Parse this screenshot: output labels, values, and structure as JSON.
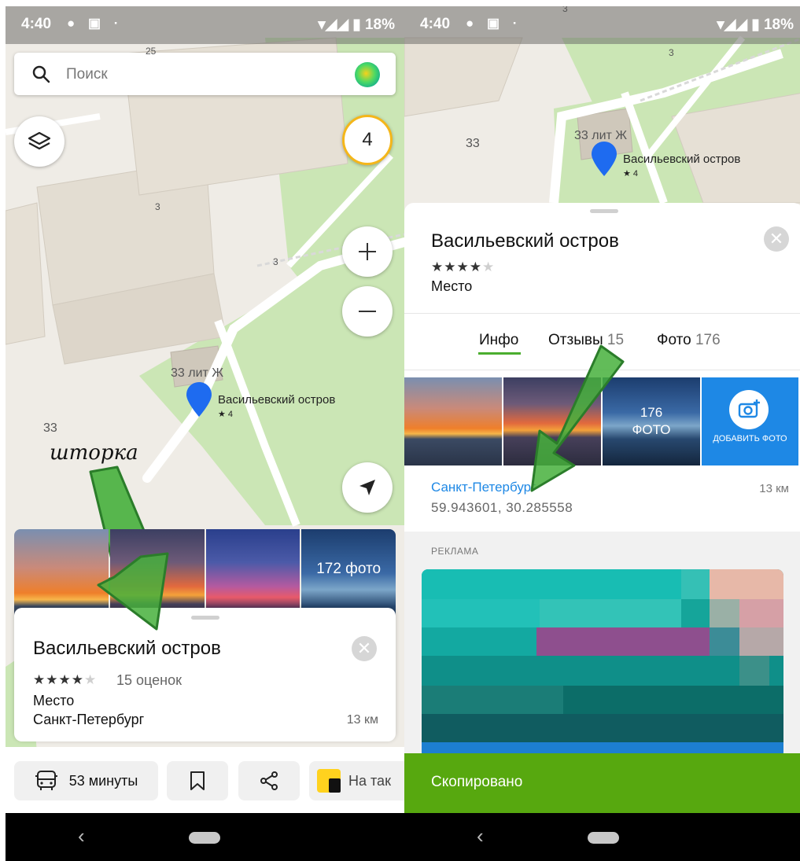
{
  "left_screen": {
    "status": {
      "time": "4:40",
      "battery": "18%"
    },
    "search": {
      "placeholder": "Поиск"
    },
    "traffic_level": "4",
    "map_labels": {
      "house_33": "33",
      "building": "33 лит Ж",
      "num_a": "3",
      "num_b": "3",
      "top_label": "25"
    },
    "poi": {
      "name": "Васильевский остров",
      "rating": "★ 4"
    },
    "annotation": "шторка",
    "photo_strip": {
      "count_label": "172 фото"
    },
    "card": {
      "title": "Васильевский остров",
      "stars": 4,
      "reviews": "15 оценок",
      "type": "Место",
      "city": "Санкт-Петербург",
      "distance": "13 км"
    },
    "bottom_bar": {
      "route": "53 минуты",
      "taxi": "На так"
    }
  },
  "right_screen": {
    "status": {
      "time": "4:40",
      "battery": "18%"
    },
    "map_labels": {
      "house_33": "33",
      "building": "33 лит Ж",
      "num_a": "3",
      "num_top": "3"
    },
    "poi": {
      "name": "Васильевский остров",
      "rating": "★ 4"
    },
    "sheet": {
      "title": "Васильевский остров",
      "stars": 4,
      "type": "Место",
      "tabs": [
        {
          "label": "Инфо",
          "count": ""
        },
        {
          "label": "Отзывы",
          "count": "15"
        },
        {
          "label": "Фото",
          "count": "176"
        }
      ],
      "photo_count": "176",
      "photo_count_word": "ФОТО",
      "add_photo": "ДОБАВИТЬ ФОТО",
      "city_link": "Санкт-Петербург",
      "coords": "59.943601, 30.285558",
      "distance": "13 км",
      "ad_label": "РЕКЛАМА"
    },
    "snackbar": "Скопировано"
  },
  "colors": {
    "accent_green": "#4bae2f",
    "link_blue": "#1e88e5",
    "pin_blue": "#1e6bf0",
    "snackbar": "#57a80f",
    "traffic_yellow": "#f4b61a",
    "annotation_arrow": "#3aa335"
  }
}
